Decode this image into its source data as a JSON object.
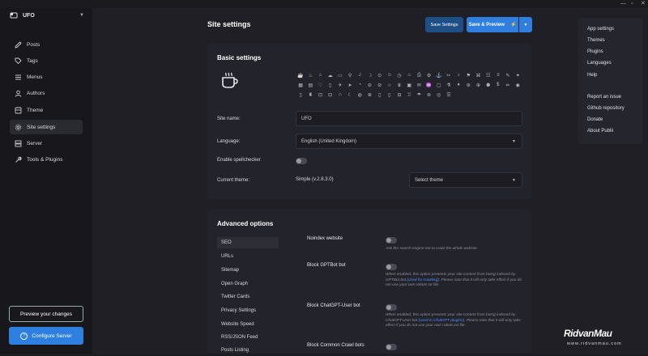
{
  "window": {
    "controls": [
      "—",
      "▫",
      "✕"
    ]
  },
  "sidebar": {
    "site_name": "UFO",
    "items": [
      {
        "label": "Posts",
        "icon": "pencil-icon"
      },
      {
        "label": "Tags",
        "icon": "tag-icon"
      },
      {
        "label": "Menus",
        "icon": "menu-icon"
      },
      {
        "label": "Authors",
        "icon": "user-icon"
      },
      {
        "label": "Theme",
        "icon": "theme-icon"
      },
      {
        "label": "Site settings",
        "icon": "gear-icon",
        "active": true
      },
      {
        "label": "Server",
        "icon": "server-icon"
      },
      {
        "label": "Tools & Plugins",
        "icon": "wrench-icon"
      }
    ],
    "preview_label": "Preview your changes",
    "configure_label": "Configure Server"
  },
  "header": {
    "title": "Site settings",
    "save_label": "Save Settings",
    "save_preview_label": "Save & Preview"
  },
  "basic": {
    "title": "Basic settings",
    "site_name_label": "Site name:",
    "site_name_value": "UFO",
    "language_label": "Language:",
    "language_value": "English (United Kingdom)",
    "spellcheck_label": "Enable spellchecker",
    "theme_label": "Current theme:",
    "theme_value": "Simple (v.2.8.3.0)",
    "theme_select_placeholder": "Select theme",
    "icons": [
      "☕",
      "♨",
      "⌂",
      "☁",
      "▭",
      "⚲",
      "♫",
      "☽",
      "⊙",
      "☺",
      "◷",
      "⌂",
      "⎙",
      "⚙",
      "⚓",
      "✂",
      "♪",
      "⚑",
      "⌘",
      "☷",
      "≡",
      "✎",
      "✦",
      "▦",
      "▤",
      "♡",
      "▯",
      "✈",
      "➤",
      "◔",
      "⊜",
      "⊘",
      "☆",
      "♛",
      "▣",
      "✉",
      "♒",
      "▢",
      "⚗",
      "♦",
      "⊛",
      "⊕",
      "⚉",
      "$",
      "✏",
      "◉",
      "▯",
      "♜",
      "⊡",
      "⊡",
      "⌂",
      "☾",
      "◍",
      "⊗",
      "▯",
      "▯",
      "⊟",
      "♖",
      "☂",
      "⊛",
      "◎",
      "☰"
    ]
  },
  "advanced": {
    "title": "Advanced options",
    "nav": [
      "SEO",
      "URLs",
      "Sitemap",
      "Open Graph",
      "Twitter Cards",
      "Privacy Settings",
      "Website Speed",
      "RSS/JSON Feed",
      "Posts Listing"
    ],
    "options": [
      {
        "title": "Noindex website",
        "desc_plain": "Ask the search engine not to crawl the whole website."
      },
      {
        "title": "Block GPTBot bot",
        "desc_pre": "When enabled, this option prevents your site content from being indexed by GPTBot bot ",
        "desc_link": "(used for crawling)",
        "desc_post": ". Please note that it will only take effect if you do not use your own robots.txt file."
      },
      {
        "title": "Block ChatGPT-User bot",
        "desc_pre": "When enabled, this option prevents your site content from being indexed by ChatGPT-User bot ",
        "desc_link": "(used in ChatGPT plugins)",
        "desc_post": ". Please note that it will only take effect if you do not use your own robots.txt file."
      },
      {
        "title": "Block Common Crawl bots"
      }
    ]
  },
  "menu": {
    "items": [
      "App settings",
      "Themes",
      "Plugins",
      "Languages",
      "Help",
      "Report an issue",
      "Github repository",
      "Donate",
      "About Publii"
    ]
  },
  "watermark": {
    "title": "RidvanMau",
    "url": "www.ridvanmau.com"
  },
  "colors": {
    "accent": "#2f7fe0",
    "save_button": "#1f4f87",
    "background": "#1f1f25",
    "sidebar": "#17171c",
    "card": "#23232b",
    "link": "#4c93ff"
  }
}
